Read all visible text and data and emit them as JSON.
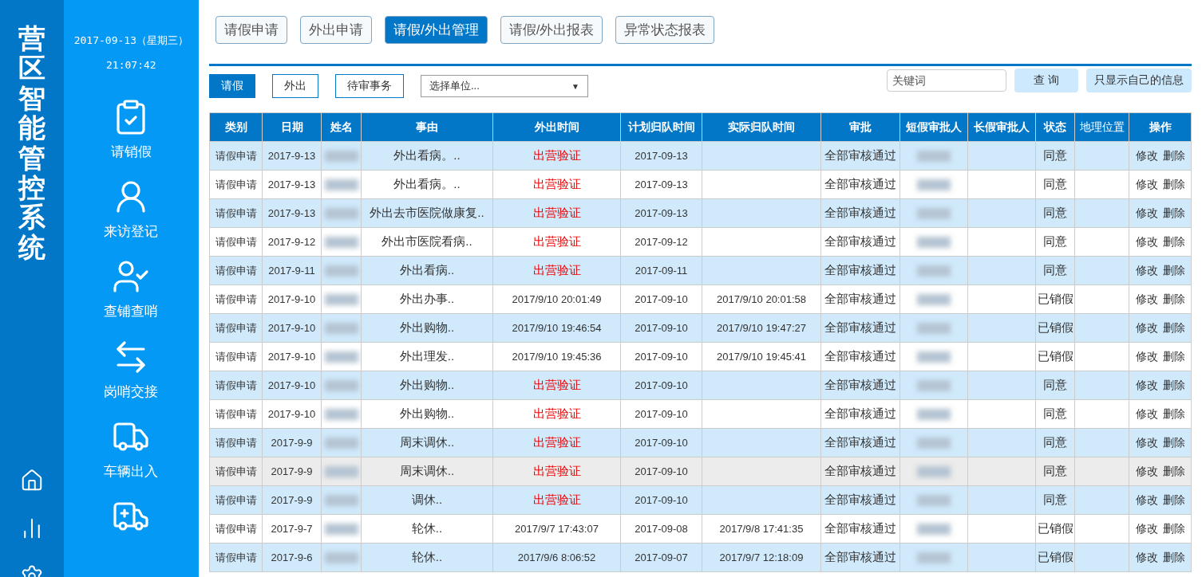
{
  "app_title": "营区智能管控系统",
  "clock": {
    "date": "2017-09-13（星期三）",
    "time": "21:07:42"
  },
  "nav_items": [
    {
      "label": "请销假",
      "kind": "clipboard"
    },
    {
      "label": "来访登记",
      "kind": "visitor"
    },
    {
      "label": "查铺查哨",
      "kind": "check"
    },
    {
      "label": "岗哨交接",
      "kind": "handover"
    },
    {
      "label": "车辆出入",
      "kind": "truck"
    },
    {
      "kind": "ambulance"
    }
  ],
  "rail_icons": [
    {
      "kind": "home"
    },
    {
      "kind": "chart"
    },
    {
      "kind": "settings"
    }
  ],
  "top_tabs": [
    {
      "label": "请假申请",
      "selected": false
    },
    {
      "label": "外出申请",
      "selected": false
    },
    {
      "label": "请假/外出管理",
      "selected": true
    },
    {
      "label": "请假/外出报表",
      "selected": false
    },
    {
      "label": "异常状态报表",
      "selected": false
    }
  ],
  "filter_tabs": [
    {
      "label": "请假",
      "selected": true
    },
    {
      "label": "外出",
      "selected": false
    },
    {
      "label": "待审事务",
      "selected": false
    }
  ],
  "unit_select": {
    "value": "选择单位...",
    "caret": "▼"
  },
  "keyword_field": {
    "placeholder": "关键词"
  },
  "search_button": "查 询",
  "mine_button": "只显示自己的信息",
  "table": {
    "columns": [
      "类别",
      "日期",
      "姓名",
      "事由",
      "外出时间",
      "计划归队时间",
      "实际归队时间",
      "审批",
      "短假审批人",
      "长假审批人",
      "状态",
      "地理位置",
      "操作"
    ],
    "rows": [
      {
        "type": "请假申请",
        "date": "2017-9-13",
        "reason": "外出看病。..",
        "out_time": {
          "kind": "verify",
          "text": "出营验证"
        },
        "planned_return": "2017-09-13",
        "approval": "全部审核通过",
        "status": "同意",
        "actions": [
          "修改",
          "删除"
        ],
        "hovered": false
      },
      {
        "type": "请假申请",
        "date": "2017-9-13",
        "reason": "外出看病。..",
        "out_time": {
          "kind": "verify",
          "text": "出营验证"
        },
        "planned_return": "2017-09-13",
        "approval": "全部审核通过",
        "status": "同意",
        "actions": [
          "修改",
          "删除"
        ],
        "hovered": false
      },
      {
        "type": "请假申请",
        "date": "2017-9-13",
        "reason": "外出去市医院做康复..",
        "out_time": {
          "kind": "verify",
          "text": "出营验证"
        },
        "planned_return": "2017-09-13",
        "approval": "全部审核通过",
        "status": "同意",
        "actions": [
          "修改",
          "删除"
        ],
        "hovered": false
      },
      {
        "type": "请假申请",
        "date": "2017-9-12",
        "reason": "外出市医院看病..",
        "out_time": {
          "kind": "verify",
          "text": "出营验证"
        },
        "planned_return": "2017-09-12",
        "approval": "全部审核通过",
        "status": "同意",
        "actions": [
          "修改",
          "删除"
        ],
        "hovered": false
      },
      {
        "type": "请假申请",
        "date": "2017-9-11",
        "reason": "外出看病..",
        "out_time": {
          "kind": "verify",
          "text": "出营验证"
        },
        "planned_return": "2017-09-11",
        "approval": "全部审核通过",
        "status": "同意",
        "actions": [
          "修改",
          "删除"
        ],
        "hovered": false
      },
      {
        "type": "请假申请",
        "date": "2017-9-10",
        "reason": "外出办事..",
        "out_time": {
          "kind": "time",
          "text": "2017/9/10 20:01:49"
        },
        "planned_return": "2017-09-10",
        "actual_return": "2017/9/10 20:01:58",
        "approval": "全部审核通过",
        "status": "已销假",
        "actions": [
          "修改",
          "删除"
        ],
        "hovered": false
      },
      {
        "type": "请假申请",
        "date": "2017-9-10",
        "reason": "外出购物..",
        "out_time": {
          "kind": "time",
          "text": "2017/9/10 19:46:54"
        },
        "planned_return": "2017-09-10",
        "actual_return": "2017/9/10 19:47:27",
        "approval": "全部审核通过",
        "status": "已销假",
        "actions": [
          "修改",
          "删除"
        ],
        "hovered": false
      },
      {
        "type": "请假申请",
        "date": "2017-9-10",
        "reason": "外出理发..",
        "out_time": {
          "kind": "time",
          "text": "2017/9/10 19:45:36"
        },
        "planned_return": "2017-09-10",
        "actual_return": "2017/9/10 19:45:41",
        "approval": "全部审核通过",
        "status": "已销假",
        "actions": [
          "修改",
          "删除"
        ],
        "hovered": false
      },
      {
        "type": "请假申请",
        "date": "2017-9-10",
        "reason": "外出购物..",
        "out_time": {
          "kind": "verify",
          "text": "出营验证"
        },
        "planned_return": "2017-09-10",
        "approval": "全部审核通过",
        "status": "同意",
        "actions": [
          "修改",
          "删除"
        ],
        "hovered": false
      },
      {
        "type": "请假申请",
        "date": "2017-9-10",
        "reason": "外出购物..",
        "out_time": {
          "kind": "verify",
          "text": "出营验证"
        },
        "planned_return": "2017-09-10",
        "approval": "全部审核通过",
        "status": "同意",
        "actions": [
          "修改",
          "删除"
        ],
        "hovered": false
      },
      {
        "type": "请假申请",
        "date": "2017-9-9",
        "reason": "周末调休..",
        "out_time": {
          "kind": "verify",
          "text": "出营验证"
        },
        "planned_return": "2017-09-10",
        "approval": "全部审核通过",
        "status": "同意",
        "actions": [
          "修改",
          "删除"
        ],
        "hovered": false
      },
      {
        "type": "请假申请",
        "date": "2017-9-9",
        "reason": "周末调休..",
        "out_time": {
          "kind": "verify",
          "text": "出营验证"
        },
        "planned_return": "2017-09-10",
        "approval": "全部审核通过",
        "status": "同意",
        "actions": [
          "修改",
          "删除"
        ],
        "hovered": true
      },
      {
        "type": "请假申请",
        "date": "2017-9-9",
        "reason": "调休..",
        "out_time": {
          "kind": "verify",
          "text": "出营验证"
        },
        "planned_return": "2017-09-10",
        "approval": "全部审核通过",
        "status": "同意",
        "actions": [
          "修改",
          "删除"
        ],
        "hovered": false
      },
      {
        "type": "请假申请",
        "date": "2017-9-7",
        "reason": "轮休..",
        "out_time": {
          "kind": "time",
          "text": "2017/9/7 17:43:07"
        },
        "planned_return": "2017-09-08",
        "actual_return": "2017/9/8 17:41:35",
        "approval": "全部审核通过",
        "status": "已销假",
        "actions": [
          "修改",
          "删除"
        ],
        "hovered": false
      },
      {
        "type": "请假申请",
        "date": "2017-9-6",
        "reason": "轮休..",
        "out_time": {
          "kind": "time",
          "text": "2017/9/6 8:06:52"
        },
        "planned_return": "2017-09-07",
        "actual_return": "2017/9/7 12:18:09",
        "approval": "全部审核通过",
        "status": "已销假",
        "actions": [
          "修改",
          "删除"
        ],
        "hovered": false
      }
    ]
  }
}
